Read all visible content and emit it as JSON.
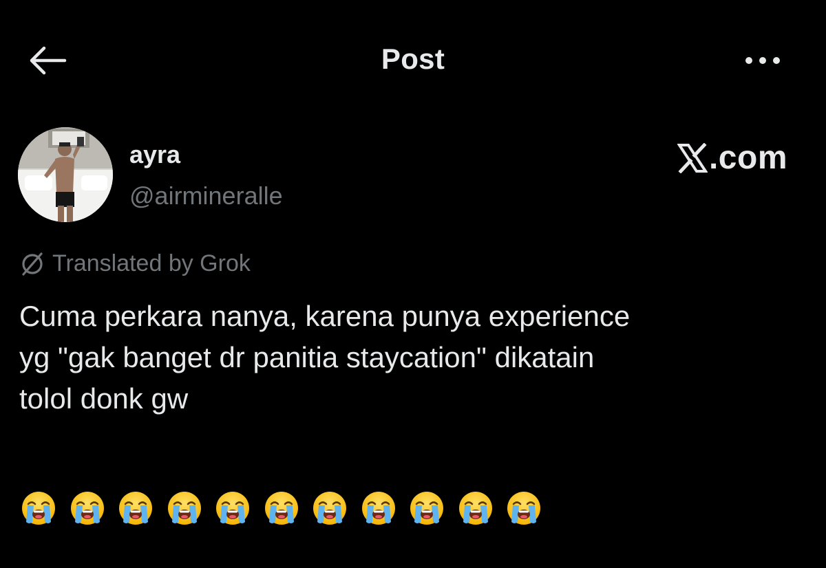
{
  "header": {
    "title": "Post",
    "back_icon": "arrow-left-icon",
    "more_icon": "more-horizontal-icon"
  },
  "author": {
    "display_name": "ayra",
    "handle": "@airmineralle",
    "avatar_icon": "profile-photo"
  },
  "brand": {
    "label": ".com",
    "logo_icon": "x-logo-icon"
  },
  "translation": {
    "label": "Translated by Grok",
    "icon": "grok-icon"
  },
  "post": {
    "text": "Cuma perkara nanya, karena punya experience\nyg \"gak banget dr panitia staycation\" dikatain\ntolol donk gw",
    "emoji": "😭",
    "emoji_count": 11,
    "emoji_icon": "loudly-crying-face-icon"
  },
  "colors": {
    "background": "#000000",
    "text_primary": "#e7e9ea",
    "text_secondary": "#71767b"
  }
}
